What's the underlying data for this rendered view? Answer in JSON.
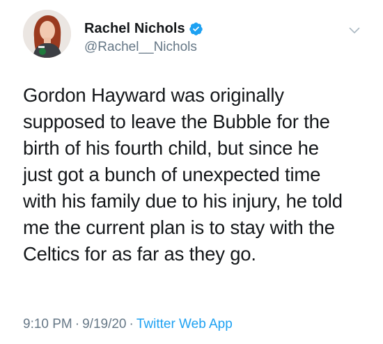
{
  "author": {
    "display_name": "Rachel Nichols",
    "handle": "@Rachel__Nichols",
    "verified": true,
    "verified_color": "#1da1f2",
    "avatar_icon": "profile-photo-avatar"
  },
  "tweet": {
    "text": "Gordon Hayward was originally\nsupposed to leave the Bubble for the\nbirth of his fourth child, but since he\njust got a bunch of unexpected time\nwith his family due to his injury, he told\nme the current plan is to stay with the\nCeltics for as far as they go."
  },
  "meta": {
    "time": "9:10 PM",
    "separator": "·",
    "date": "9/19/20",
    "source": "Twitter Web App",
    "source_color": "#1da1f2"
  },
  "menu": {
    "icon": "chevron-down-icon"
  }
}
